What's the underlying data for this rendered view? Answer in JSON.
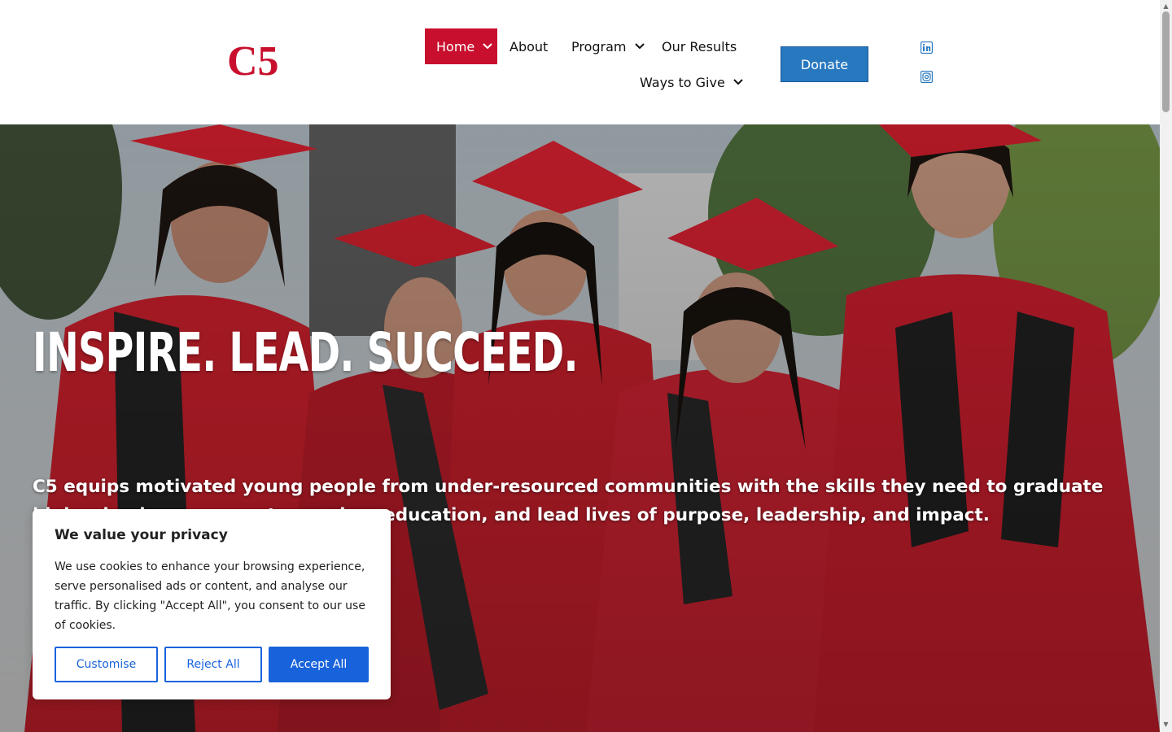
{
  "header": {
    "logo_text": "C5",
    "nav": [
      {
        "label": "Home",
        "has_dropdown": true,
        "active": true
      },
      {
        "label": "About",
        "has_dropdown": false
      },
      {
        "label": "Program",
        "has_dropdown": true
      },
      {
        "label": "Our Results",
        "has_dropdown": false
      },
      {
        "label": "Ways to Give",
        "has_dropdown": true
      }
    ],
    "donate_label": "Donate",
    "social": [
      "linkedin-icon",
      "instagram-icon"
    ]
  },
  "hero": {
    "title": "INSPIRE. LEAD. SUCCEED.",
    "text": "C5 equips motivated young people from under-resourced communities with the skills they need to graduate high school, pursue postsecondary education, and lead lives of purpose, leadership, and impact."
  },
  "cookie": {
    "title": "We value your privacy",
    "text": "We use cookies to enhance your browsing experience, serve personalised ads or content, and analyse our traffic. By clicking \"Accept All\", you consent to our use of cookies.",
    "customise_label": "Customise",
    "reject_label": "Reject All",
    "accept_label": "Accept All"
  },
  "colors": {
    "brand_red": "#c8102e",
    "donate_blue": "#2878c0",
    "cookie_blue": "#1863dc"
  }
}
